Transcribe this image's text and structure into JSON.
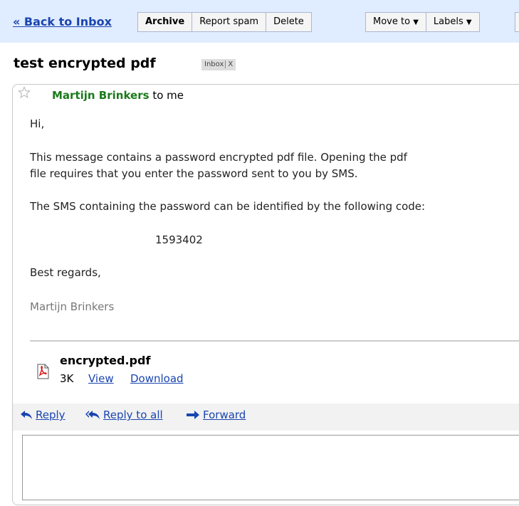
{
  "toolbar": {
    "back_label": "« Back to Inbox",
    "archive_label": "Archive",
    "report_spam_label": "Report spam",
    "delete_label": "Delete",
    "move_to_label": "Move to",
    "labels_label": "Labels",
    "dropdown_glyph": "▼"
  },
  "message": {
    "subject": "test encrypted pdf",
    "label_tag": "Inbox",
    "label_remove": "X",
    "sender_name": "Martijn Brinkers",
    "recipient_text": "to me",
    "body": {
      "greeting": "Hi,",
      "paragraph1_line1": "This message contains a password encrypted pdf file. Opening the pdf",
      "paragraph1_line2": "file requires that you enter the password sent to you by SMS.",
      "paragraph2": "The SMS containing the password can be identified by the following code:",
      "code": "1593402",
      "closing": "Best regards,",
      "signature": "Martijn Brinkers"
    },
    "attachment": {
      "filename": "encrypted.pdf",
      "size": "3K",
      "view_label": "View",
      "download_label": "Download"
    }
  },
  "reply_actions": {
    "reply_label": "Reply",
    "reply_all_label": "Reply to all",
    "forward_label": "Forward"
  },
  "colors": {
    "toolbar_bg": "#e0ecff",
    "link": "#1a45b0",
    "sender": "#1a7a1a"
  }
}
